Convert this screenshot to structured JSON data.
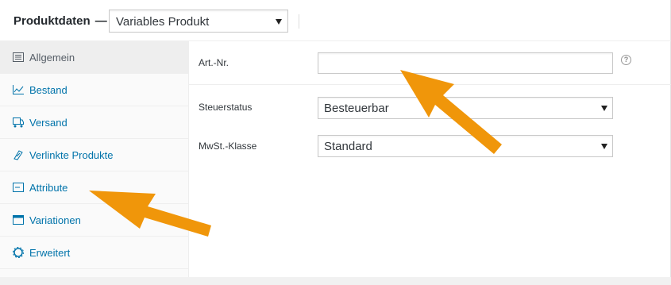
{
  "header": {
    "title": "Produktdaten",
    "separator": "—",
    "product_type": {
      "selected": "Variables Produkt"
    }
  },
  "tabs": [
    {
      "label": "Allgemein",
      "icon": "general-icon",
      "active": true
    },
    {
      "label": "Bestand",
      "icon": "inventory-chart-icon"
    },
    {
      "label": "Versand",
      "icon": "shipping-truck-icon"
    },
    {
      "label": "Verlinkte Produkte",
      "icon": "link-icon"
    },
    {
      "label": "Attribute",
      "icon": "attribute-icon"
    },
    {
      "label": "Variationen",
      "icon": "variations-icon"
    },
    {
      "label": "Erweitert",
      "icon": "gear-icon"
    }
  ],
  "fields": {
    "sku": {
      "label": "Art.-Nr.",
      "value": ""
    },
    "tax_status": {
      "label": "Steuerstatus",
      "selected": "Besteuerbar"
    },
    "tax_class": {
      "label": "MwSt.-Klasse",
      "selected": "Standard"
    }
  },
  "annotation_color": "#f0960a"
}
